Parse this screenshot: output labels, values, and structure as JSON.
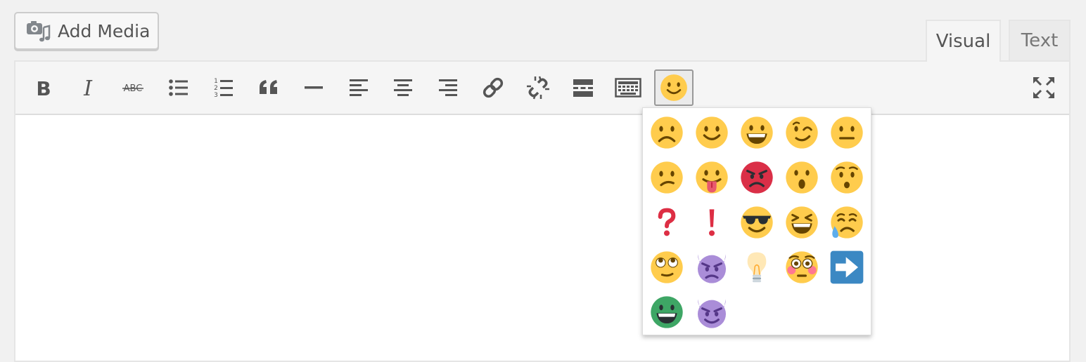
{
  "add_media": {
    "label": "Add Media",
    "icon": "media-camera-music-icon"
  },
  "tabs": [
    {
      "label": "Visual",
      "active": true
    },
    {
      "label": "Text",
      "active": false
    }
  ],
  "toolbar": {
    "buttons": [
      {
        "name": "bold",
        "icon": "bold-icon",
        "glyph": "B"
      },
      {
        "name": "italic",
        "icon": "italic-icon",
        "glyph": "I"
      },
      {
        "name": "strikethrough",
        "icon": "strikethrough-icon",
        "glyph": "ABC"
      },
      {
        "name": "bulleted-list",
        "icon": "bulleted-list-icon"
      },
      {
        "name": "numbered-list",
        "icon": "numbered-list-icon",
        "glyphs": [
          "1",
          "2",
          "3"
        ]
      },
      {
        "name": "blockquote",
        "icon": "blockquote-icon"
      },
      {
        "name": "horizontal-line",
        "icon": "horizontal-line-icon"
      },
      {
        "name": "align-left",
        "icon": "align-left-icon"
      },
      {
        "name": "align-center",
        "icon": "align-center-icon"
      },
      {
        "name": "align-right",
        "icon": "align-right-icon"
      },
      {
        "name": "insert-link",
        "icon": "link-icon"
      },
      {
        "name": "remove-link",
        "icon": "unlink-icon"
      },
      {
        "name": "read-more",
        "icon": "read-more-icon"
      },
      {
        "name": "toolbar-toggle",
        "icon": "keyboard-icon"
      },
      {
        "name": "emoji",
        "icon": "smiley-icon",
        "active": true
      },
      {
        "name": "fullscreen",
        "icon": "fullscreen-icon"
      }
    ]
  },
  "emoji_panel": {
    "open": true,
    "emojis": [
      "frowning",
      "smiling",
      "grinning",
      "winking",
      "neutral",
      "confused",
      "tongue-out",
      "angry",
      "surprised",
      "hushed",
      "question",
      "exclamation",
      "sunglasses",
      "laughing",
      "sweat",
      "eye-roll",
      "imp",
      "light-bulb",
      "flushed",
      "right-arrow",
      "green-grin",
      "smiling-imp"
    ]
  },
  "colors": {
    "emoji_yellow": "#ffcc4d",
    "emoji_feature": "#664500",
    "angry_red": "#da2f47",
    "mark_red": "#dd2e44",
    "devil_purple": "#aa8dd8",
    "arrow_blue": "#3b88c3",
    "green_face": "#3ea665",
    "icon_gray": "#555555"
  }
}
